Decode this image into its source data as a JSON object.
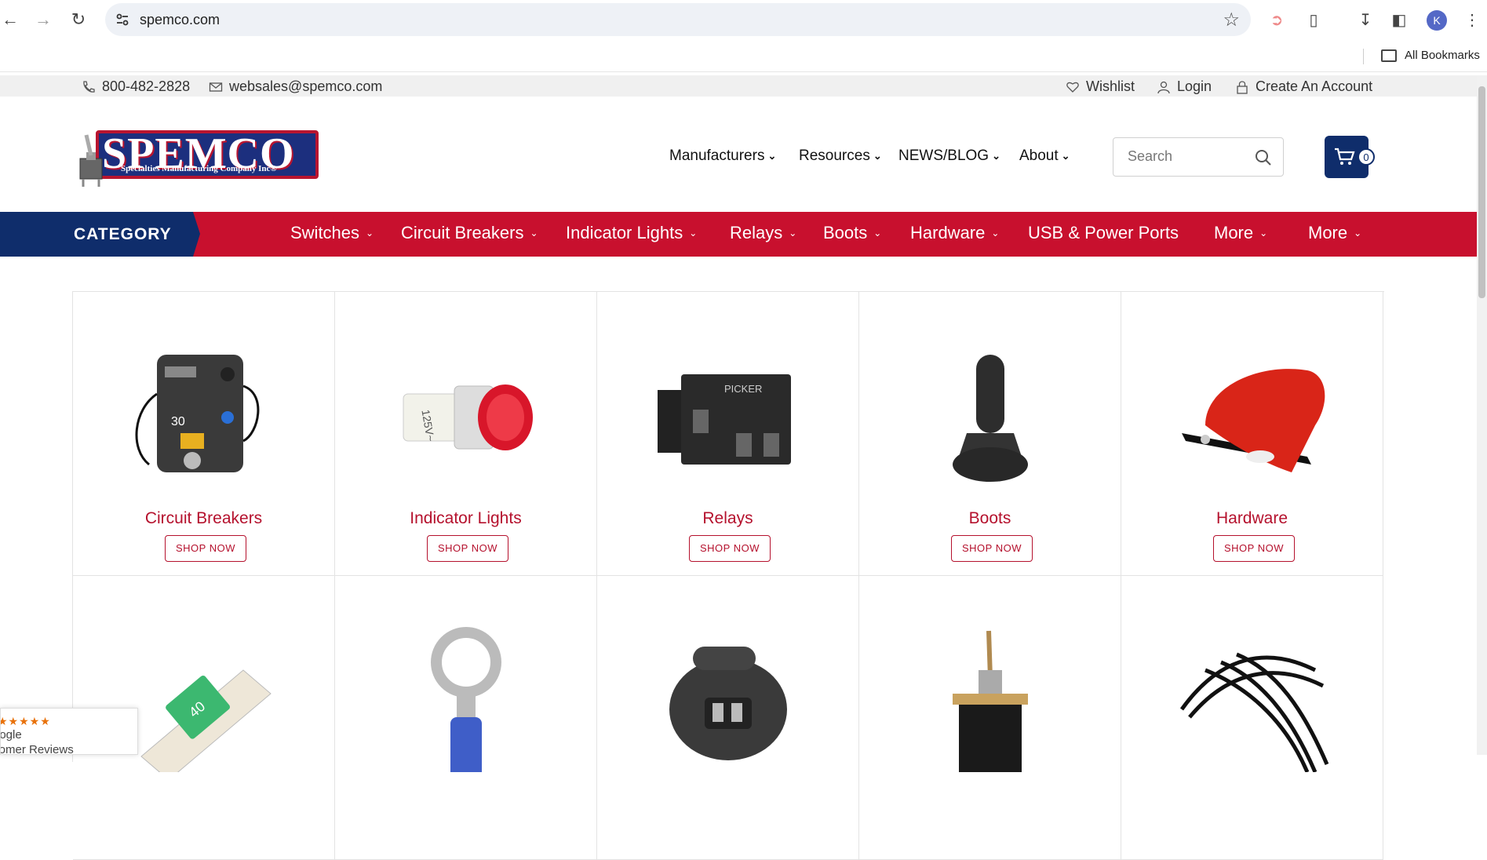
{
  "browser": {
    "url": "spemco.com",
    "bookmarks_label": "All Bookmarks",
    "avatar_letter": "K"
  },
  "topbar": {
    "phone": "800-482-2828",
    "email": "websales@spemco.com",
    "wishlist": "Wishlist",
    "login": "Login",
    "create_account": "Create An Account"
  },
  "logo": {
    "word": "SPEMCO",
    "subtitle": "Specialties Manufacturing Company Inc®"
  },
  "main_nav": [
    {
      "label": "Manufacturers"
    },
    {
      "label": "Resources"
    },
    {
      "label": "NEWS/BLOG"
    },
    {
      "label": "About"
    }
  ],
  "search": {
    "placeholder": "Search"
  },
  "cart": {
    "count": "0"
  },
  "category_bar": {
    "label": "CATEGORY",
    "items": [
      {
        "label": "Switches",
        "dropdown": true
      },
      {
        "label": "Circuit Breakers",
        "dropdown": true
      },
      {
        "label": "Indicator Lights",
        "dropdown": true
      },
      {
        "label": "Relays",
        "dropdown": true
      },
      {
        "label": "Boots",
        "dropdown": true
      },
      {
        "label": "Hardware",
        "dropdown": true
      },
      {
        "label": "USB & Power Ports",
        "dropdown": false
      },
      {
        "label": "More",
        "dropdown": true
      },
      {
        "label": "More",
        "dropdown": true
      }
    ]
  },
  "products": [
    {
      "name": "Circuit Breakers",
      "button": "SHOP NOW",
      "icon": "circuit-breaker-image"
    },
    {
      "name": "Indicator Lights",
      "button": "SHOP NOW",
      "icon": "indicator-light-image"
    },
    {
      "name": "Relays",
      "button": "SHOP NOW",
      "icon": "relay-image"
    },
    {
      "name": "Boots",
      "button": "SHOP NOW",
      "icon": "boot-image"
    },
    {
      "name": "Hardware",
      "button": "SHOP NOW",
      "icon": "hardware-image"
    }
  ],
  "products_row2": [
    {
      "icon": "fuse-image"
    },
    {
      "icon": "ring-terminal-image"
    },
    {
      "icon": "usb-port-image"
    },
    {
      "icon": "toggle-switch-image"
    },
    {
      "icon": "cable-ties-image"
    }
  ],
  "reviews": {
    "stars": "★★★★★",
    "line1": "oogle",
    "line2": "stomer Reviews"
  },
  "colors": {
    "brand_red": "#c8102e",
    "brand_navy": "#0f2d6b"
  }
}
